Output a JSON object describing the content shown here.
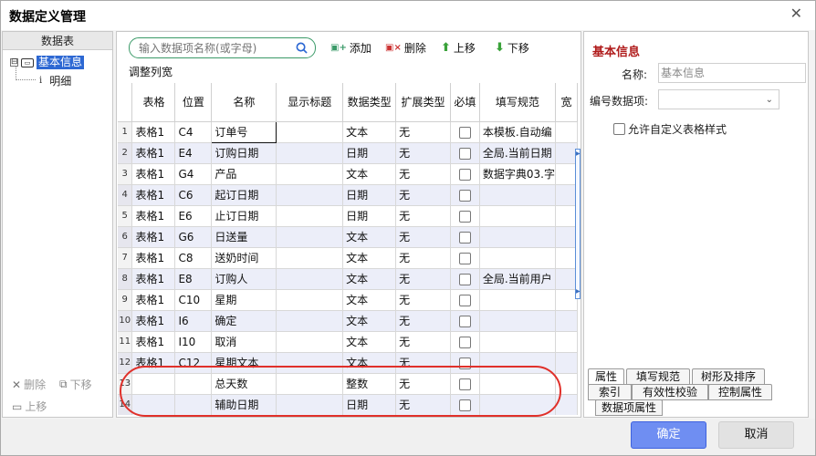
{
  "window": {
    "title": "数据定义管理",
    "close": "✕"
  },
  "left": {
    "header": "数据表",
    "tree_root": "基本信息",
    "tree_toggle": "⊟",
    "tree_child": "明细",
    "tree_child_icon": "i",
    "delete": "删除",
    "move_down": "下移",
    "move_up": "上移"
  },
  "toolbar": {
    "search_placeholder": "输入数据项名称(或字母)",
    "add": "添加",
    "delete": "删除",
    "move_up": "上移",
    "move_down": "下移",
    "adjust_width": "调整列宽"
  },
  "grid": {
    "columns": [
      "表格",
      "位置",
      "名称",
      "显示标题",
      "数据类型",
      "扩展类型",
      "必填",
      "填写规范",
      "宽"
    ],
    "rows": [
      {
        "n": "1",
        "table": "表格1",
        "pos": "C4",
        "name": "订单号",
        "title": "",
        "dtype": "文本",
        "ext": "无",
        "rule": "本模板.自动编"
      },
      {
        "n": "2",
        "table": "表格1",
        "pos": "E4",
        "name": "订购日期",
        "title": "",
        "dtype": "日期",
        "ext": "无",
        "rule": "全局.当前日期"
      },
      {
        "n": "3",
        "table": "表格1",
        "pos": "G4",
        "name": "产品",
        "title": "",
        "dtype": "文本",
        "ext": "无",
        "rule": "数据字典03.字"
      },
      {
        "n": "4",
        "table": "表格1",
        "pos": "C6",
        "name": "起订日期",
        "title": "",
        "dtype": "日期",
        "ext": "无",
        "rule": ""
      },
      {
        "n": "5",
        "table": "表格1",
        "pos": "E6",
        "name": "止订日期",
        "title": "",
        "dtype": "日期",
        "ext": "无",
        "rule": ""
      },
      {
        "n": "6",
        "table": "表格1",
        "pos": "G6",
        "name": "日送量",
        "title": "",
        "dtype": "文本",
        "ext": "无",
        "rule": ""
      },
      {
        "n": "7",
        "table": "表格1",
        "pos": "C8",
        "name": "送奶时间",
        "title": "",
        "dtype": "文本",
        "ext": "无",
        "rule": ""
      },
      {
        "n": "8",
        "table": "表格1",
        "pos": "E8",
        "name": "订购人",
        "title": "",
        "dtype": "文本",
        "ext": "无",
        "rule": "全局.当前用户"
      },
      {
        "n": "9",
        "table": "表格1",
        "pos": "C10",
        "name": "星期",
        "title": "",
        "dtype": "文本",
        "ext": "无",
        "rule": ""
      },
      {
        "n": "10",
        "table": "表格1",
        "pos": "I6",
        "name": "确定",
        "title": "",
        "dtype": "文本",
        "ext": "无",
        "rule": ""
      },
      {
        "n": "11",
        "table": "表格1",
        "pos": "I10",
        "name": "取消",
        "title": "",
        "dtype": "文本",
        "ext": "无",
        "rule": ""
      },
      {
        "n": "12",
        "table": "表格1",
        "pos": "C12",
        "name": "星期文本",
        "title": "",
        "dtype": "文本",
        "ext": "无",
        "rule": ""
      },
      {
        "n": "13",
        "table": "",
        "pos": "",
        "name": "总天数",
        "title": "",
        "dtype": "整数",
        "ext": "无",
        "rule": ""
      },
      {
        "n": "14",
        "table": "",
        "pos": "",
        "name": "辅助日期",
        "title": "",
        "dtype": "日期",
        "ext": "无",
        "rule": ""
      }
    ]
  },
  "right": {
    "section_title": "基本信息",
    "name_label": "名称:",
    "name_value": "基本信息",
    "number_label": "编号数据项:",
    "number_value": "",
    "allow_custom": "允许自定义表格样式",
    "tabs": [
      "属性",
      "填写规范",
      "树形及排序",
      "索引",
      "有效性校验",
      "控制属性",
      "数据项属性"
    ]
  },
  "footer": {
    "ok": "确定",
    "cancel": "取消"
  },
  "colors": {
    "accent": "#6f8ef2",
    "highlight": "#e0302a",
    "section_title": "#b01c1c",
    "selected": "#2d68d3"
  }
}
